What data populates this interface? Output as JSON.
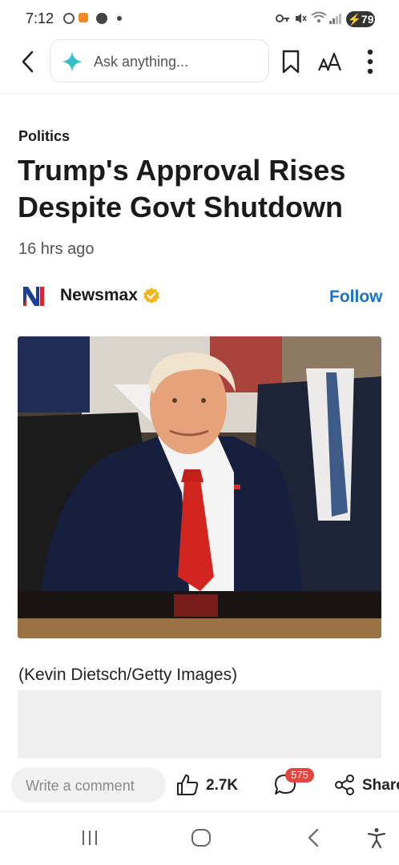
{
  "status_bar": {
    "time": "7:12",
    "battery": "79"
  },
  "header": {
    "search_placeholder": "Ask anything...",
    "back_icon": "chevron-left-icon",
    "bookmark_icon": "bookmark-icon",
    "text_size_icon": "text-size-icon",
    "more_icon": "more-vertical-icon"
  },
  "article": {
    "category": "Politics",
    "headline": "Trump's Approval Rises Despite Govt Shutdown",
    "time_ago": "16 hrs ago",
    "publisher": {
      "name": "Newsmax",
      "follow_label": "Follow"
    },
    "image_caption": "(Kevin Dietsch/Getty Images)"
  },
  "actions": {
    "comment_placeholder": "Write a comment",
    "likes": "2.7K",
    "comments_badge": "575",
    "share_label": "Share"
  },
  "colors": {
    "accent": "#1a73c8",
    "badge": "#e2463e",
    "verified": "#f2b61b"
  }
}
